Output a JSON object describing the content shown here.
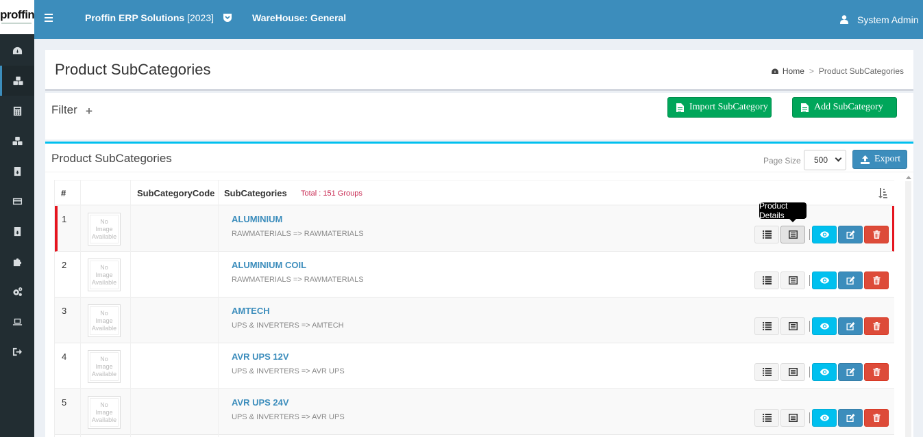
{
  "app": {
    "logo_text": "proffin",
    "title": "Proffin ERP Solutions",
    "year": "[2023]",
    "warehouse": "WareHouse: General",
    "user": "System Admin"
  },
  "sidebar": {
    "items": [
      {
        "icon": "dashboard-icon"
      },
      {
        "icon": "cubes-icon",
        "active": true
      },
      {
        "icon": "calculator-icon"
      },
      {
        "icon": "cubes-icon"
      },
      {
        "icon": "archive-icon"
      },
      {
        "icon": "credit-card-icon"
      },
      {
        "icon": "archive-icon"
      },
      {
        "icon": "puzzle-icon"
      },
      {
        "icon": "gears-icon"
      },
      {
        "icon": "laptop-icon"
      },
      {
        "icon": "sign-out-icon"
      }
    ]
  },
  "page": {
    "title": "Product SubCategories",
    "breadcrumb": {
      "home": "Home",
      "separator": ">",
      "current": "Product SubCategories"
    }
  },
  "filter": {
    "title": "Filter",
    "toggle": "+",
    "import_label": "Import SubCategory",
    "add_label": "Add SubCategory"
  },
  "list": {
    "title": "Product SubCategories",
    "page_size_label": "Page Size",
    "page_size": "500",
    "export_label": "Export",
    "columns": {
      "num": "#",
      "code": "SubCategoryCode",
      "name": "SubCategories"
    },
    "total": "Total : 151 Groups",
    "no_image": [
      "No",
      "Image",
      "Available"
    ],
    "tooltip": "Product Details",
    "rows": [
      {
        "num": "1",
        "name": "ALUMINIUM",
        "path": "RAWMATERIALS => RAWMATERIALS"
      },
      {
        "num": "2",
        "name": "ALUMINIUM COIL",
        "path": "RAWMATERIALS => RAWMATERIALS"
      },
      {
        "num": "3",
        "name": "AMTECH",
        "path": "UPS & INVERTERS => AMTECH"
      },
      {
        "num": "4",
        "name": "AVR UPS 12V",
        "path": "UPS & INVERTERS => AVR UPS"
      },
      {
        "num": "5",
        "name": "AVR UPS 24V",
        "path": "UPS & INVERTERS => AVR UPS"
      }
    ]
  },
  "colors": {
    "header": "#3c8dbc",
    "sidebar": "#222d32",
    "green": "#00a65a",
    "info": "#00c0ef",
    "danger": "#dd4b39",
    "highlight": "#e5151f"
  }
}
